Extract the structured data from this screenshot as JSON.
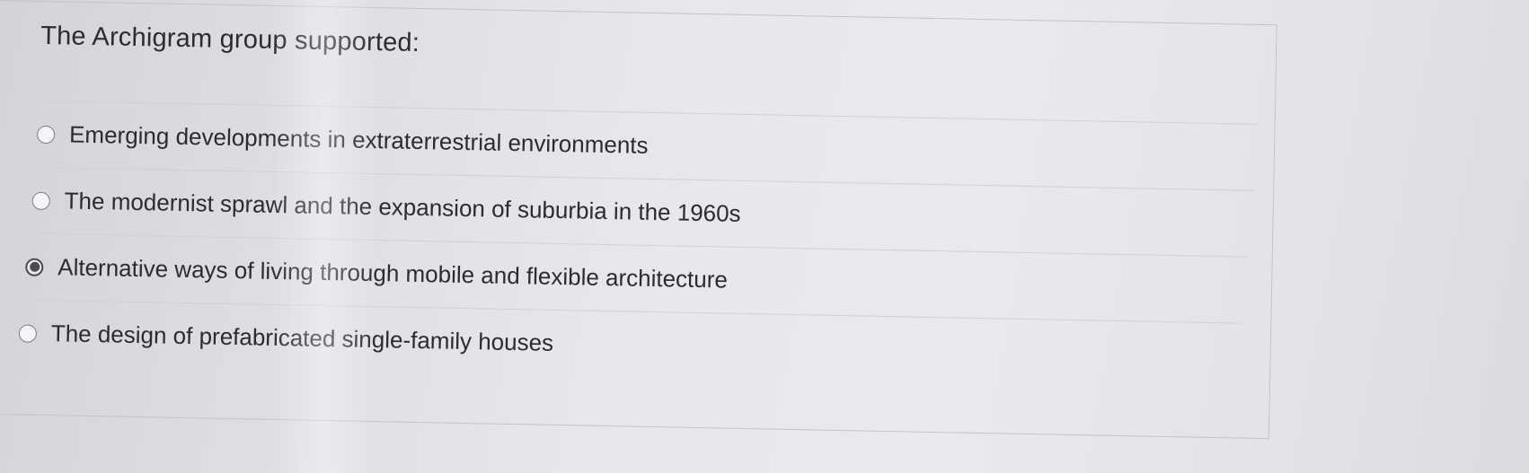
{
  "question": {
    "text": "The Archigram group supported:"
  },
  "answers": [
    {
      "label": "Emerging developments in extraterrestrial environments",
      "selected": false
    },
    {
      "label": "The modernist sprawl and the expansion of suburbia in the 1960s",
      "selected": false
    },
    {
      "label": "Alternative ways of living through mobile and flexible architecture",
      "selected": true
    },
    {
      "label": "The design of prefabricated single-family houses",
      "selected": false
    }
  ]
}
